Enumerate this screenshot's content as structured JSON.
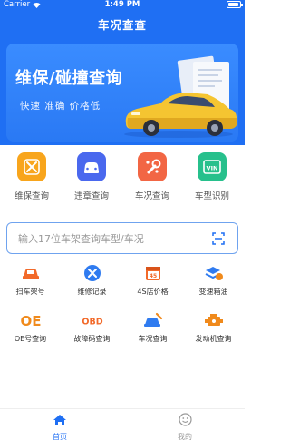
{
  "status_bar": {
    "carrier": "Carrier",
    "time": "1:49 PM"
  },
  "nav": {
    "title": "车况查查"
  },
  "banner": {
    "title": "维保/碰撞查询",
    "subtitle": "快速 准确 价格低"
  },
  "main_features": [
    {
      "label": "维保查询",
      "icon": "wrench-screwdriver-icon",
      "color": "#f8a51c"
    },
    {
      "label": "违章查询",
      "icon": "car-front-icon",
      "color": "#4a68ee"
    },
    {
      "label": "车况查询",
      "icon": "wrench-icon",
      "color": "#f26644"
    },
    {
      "label": "车型识别",
      "icon": "vin-icon",
      "color": "#27c08c"
    }
  ],
  "search": {
    "placeholder": "输入17位车架查询车型/车况"
  },
  "tools": [
    {
      "label": "扫车架号",
      "icon": "scan-car-icon",
      "color": "#f26a2a"
    },
    {
      "label": "维修记录",
      "icon": "tools-icon",
      "color": "#2f7bf0"
    },
    {
      "label": "4S店价格",
      "icon": "calendar-45-icon",
      "color": "#f26a2a",
      "badge": "45"
    },
    {
      "label": "变速箱油",
      "icon": "oil-layers-icon",
      "color": "#2f7bf0"
    },
    {
      "label": "OE号查询",
      "icon": "oe-icon",
      "color": "#f08a1c",
      "badge": "OE"
    },
    {
      "label": "故障码查询",
      "icon": "obd-icon",
      "color": "#f26a2a",
      "badge": "OBD"
    },
    {
      "label": "车况查询",
      "icon": "car-wrench-icon",
      "color": "#2f7bf0"
    },
    {
      "label": "发动机查询",
      "icon": "engine-icon",
      "color": "#f08a1c"
    }
  ],
  "tabbar": {
    "items": [
      {
        "label": "首页",
        "icon": "home-icon",
        "active": true
      },
      {
        "label": "我的",
        "icon": "smiley-icon",
        "active": false
      }
    ],
    "active_color": "#1f6ff3",
    "inactive_color": "#999999"
  }
}
